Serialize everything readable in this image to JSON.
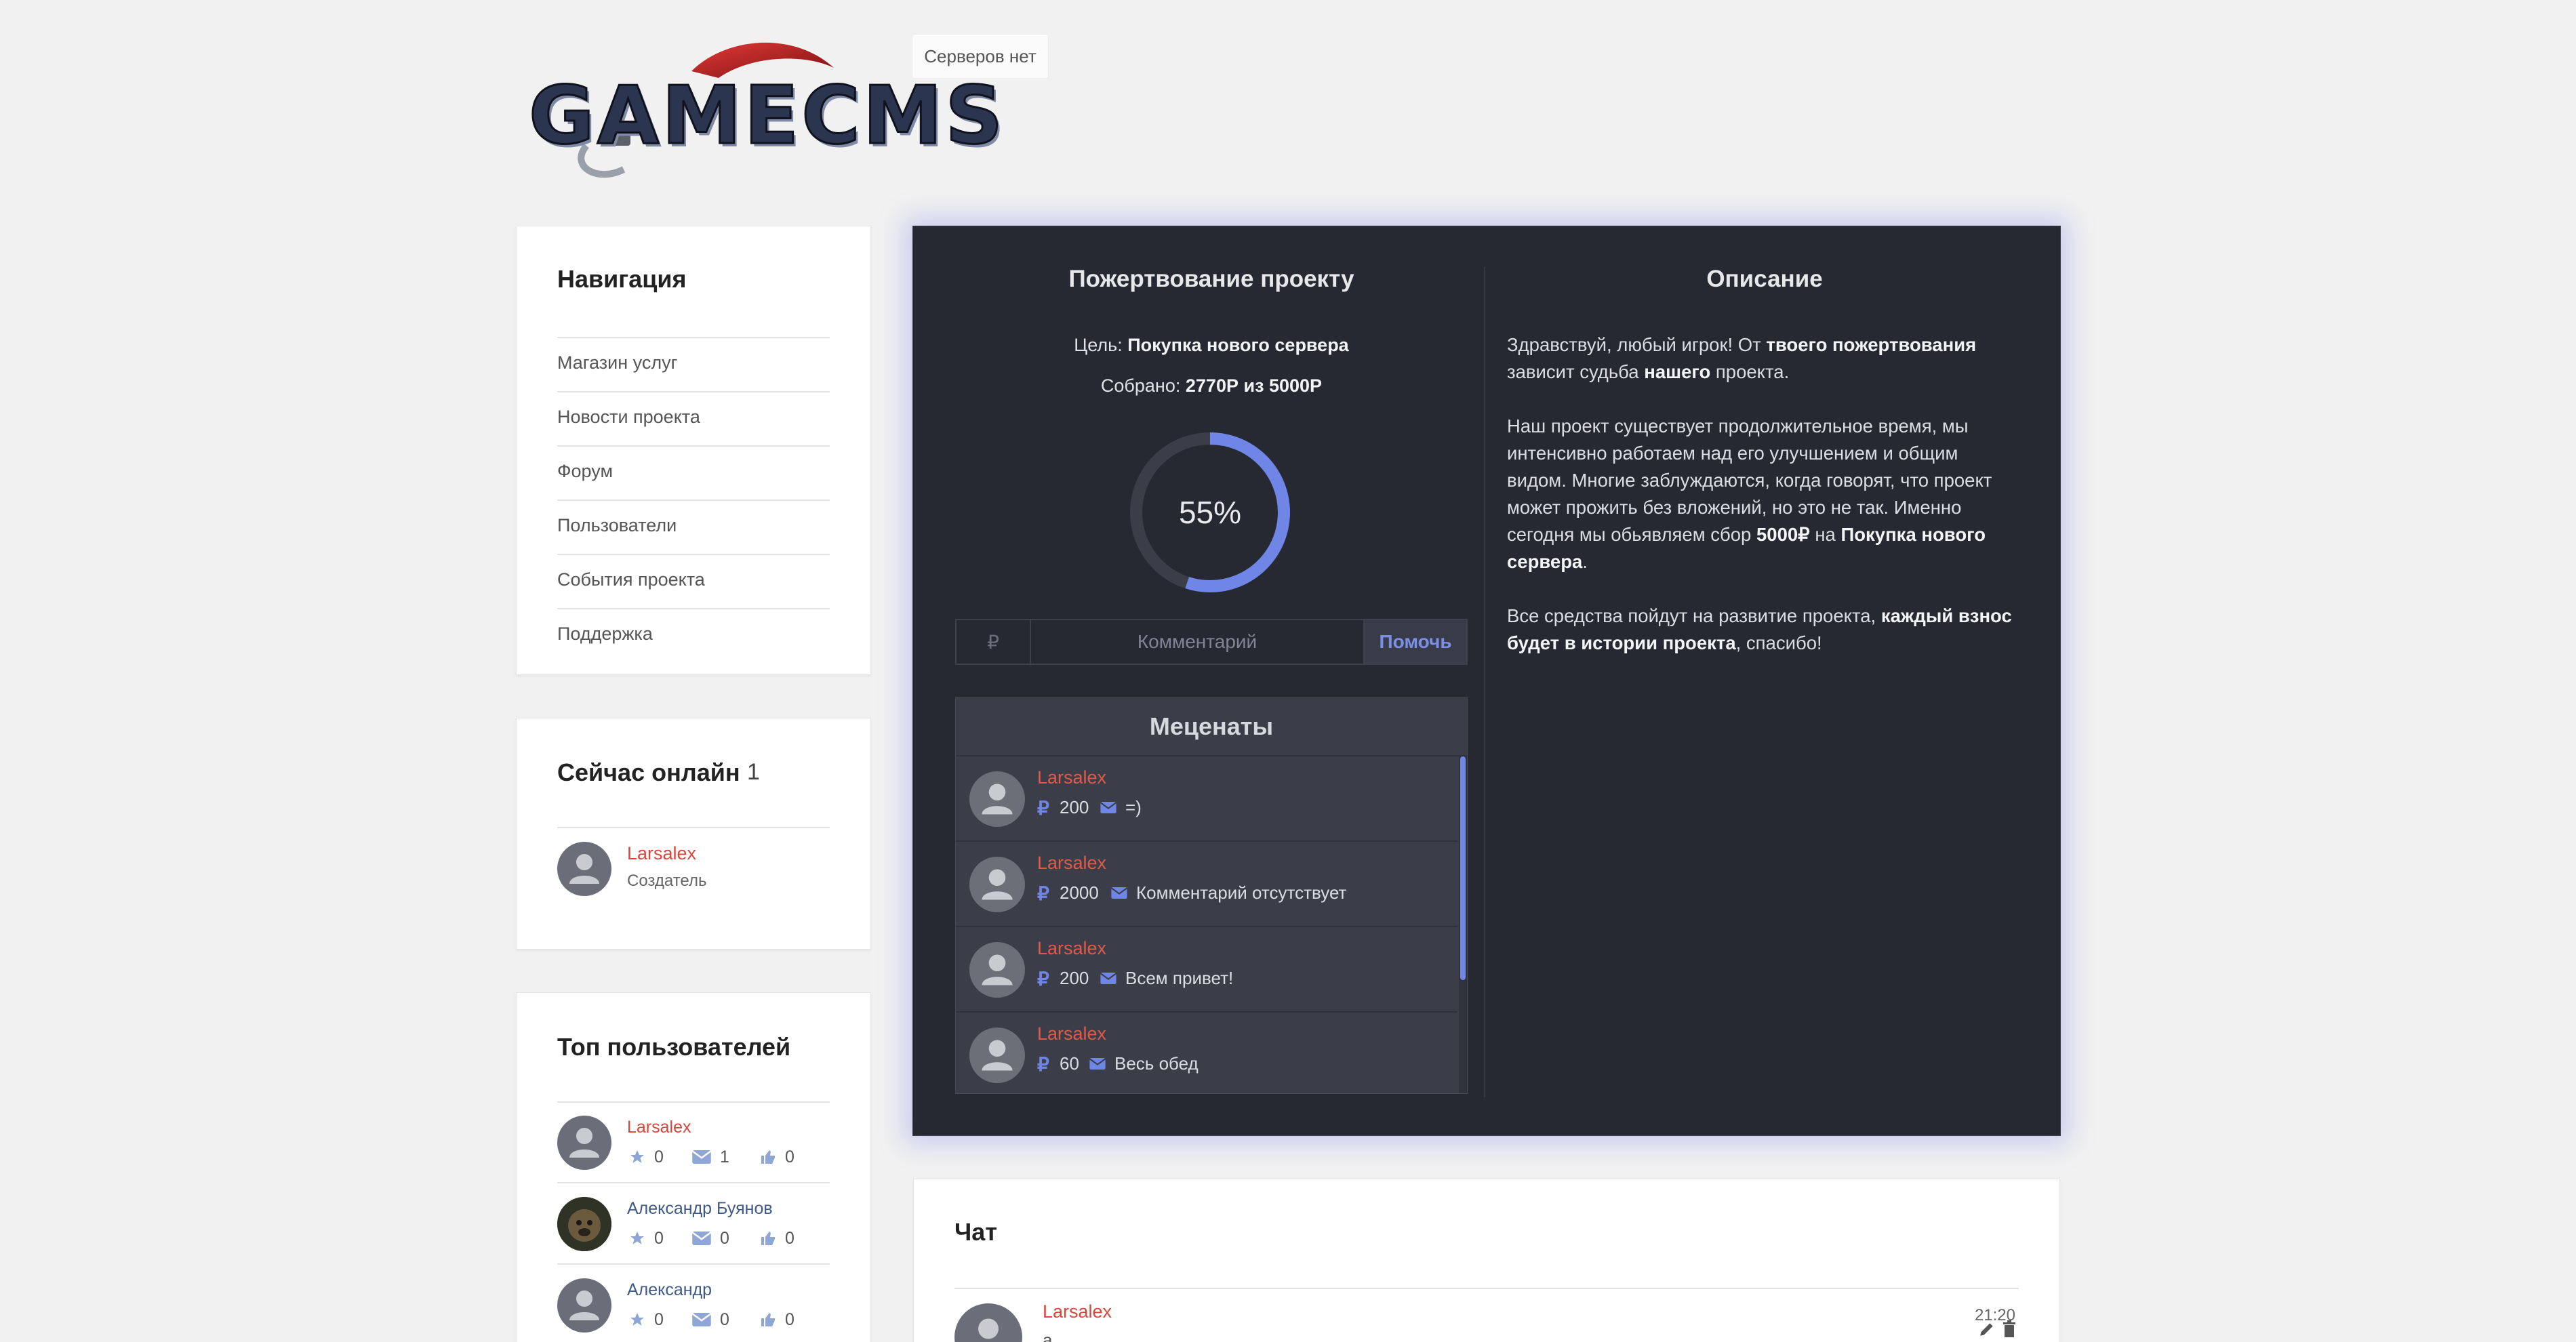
{
  "header": {
    "logo_text": "GAMECMS",
    "servers_label": "Серверов нет"
  },
  "navigation": {
    "title": "Навигация",
    "items": [
      {
        "label": "Магазин услуг"
      },
      {
        "label": "Новости проекта"
      },
      {
        "label": "Форум"
      },
      {
        "label": "Пользователи"
      },
      {
        "label": "События проекта"
      },
      {
        "label": "Поддержка"
      }
    ]
  },
  "online": {
    "title": "Сейчас онлайн",
    "count": "1",
    "users": [
      {
        "name": "Larsalex",
        "role": "Создатель"
      }
    ]
  },
  "top_users": {
    "title": "Топ пользователей",
    "users": [
      {
        "name": "Larsalex",
        "stars": "0",
        "messages": "1",
        "likes": "0",
        "color": "#d9463c"
      },
      {
        "name": "Александр Буянов",
        "stars": "0",
        "messages": "0",
        "likes": "0",
        "color": "#3f5a88"
      },
      {
        "name": "Александр",
        "stars": "0",
        "messages": "0",
        "likes": "0",
        "color": "#3f5a88"
      }
    ]
  },
  "donation": {
    "title": "Пожертвование проекту",
    "goal_label": "Цель:",
    "goal_value": "Покупка нового сервера",
    "collected_label": "Собрано:",
    "collected_value": "2770Р из 5000Р",
    "progress_percent": 55,
    "progress_text": "55%",
    "currency_symbol": "₽",
    "comment_placeholder": "Комментарий",
    "help_button": "Помочь",
    "patrons_title": "Меценаты",
    "patrons": [
      {
        "name": "Larsalex",
        "amount": "200",
        "comment": "=)"
      },
      {
        "name": "Larsalex",
        "amount": "2000",
        "comment": "Комментарий отсутствует"
      },
      {
        "name": "Larsalex",
        "amount": "200",
        "comment": "Всем привет!"
      },
      {
        "name": "Larsalex",
        "amount": "60",
        "comment": "Весь обед"
      }
    ]
  },
  "description": {
    "title": "Описание",
    "p1_a": "Здравствуй, любый игрок! От ",
    "p1_b": "твоего пожертвования",
    "p1_c": " зависит судьба ",
    "p1_d": "нашего",
    "p1_e": " проекта.",
    "p2_a": "Наш проект существует продолжительное время, мы интенсивно работаем над его улучшением и общим видом. Многие заблуждаются, когда говорят, что проект может прожить без вложений, но это не так. Именно сегодня мы обьявляем сбор ",
    "p2_b": "5000₽",
    "p2_c": " на ",
    "p2_d": "Покупка нового сервера",
    "p2_e": ".",
    "p3_a": "Все средства пойдут на развитие проекта, ",
    "p3_b": "каждый взнос будет в истории проекта",
    "p3_c": ", спасибо!"
  },
  "chat": {
    "title": "Чат",
    "messages": [
      {
        "name": "Larsalex",
        "time": "21:20",
        "text": "а"
      }
    ]
  },
  "colors": {
    "accent": "#6f86e6",
    "username_red": "#d9463c",
    "dark_panel": "#262932"
  }
}
